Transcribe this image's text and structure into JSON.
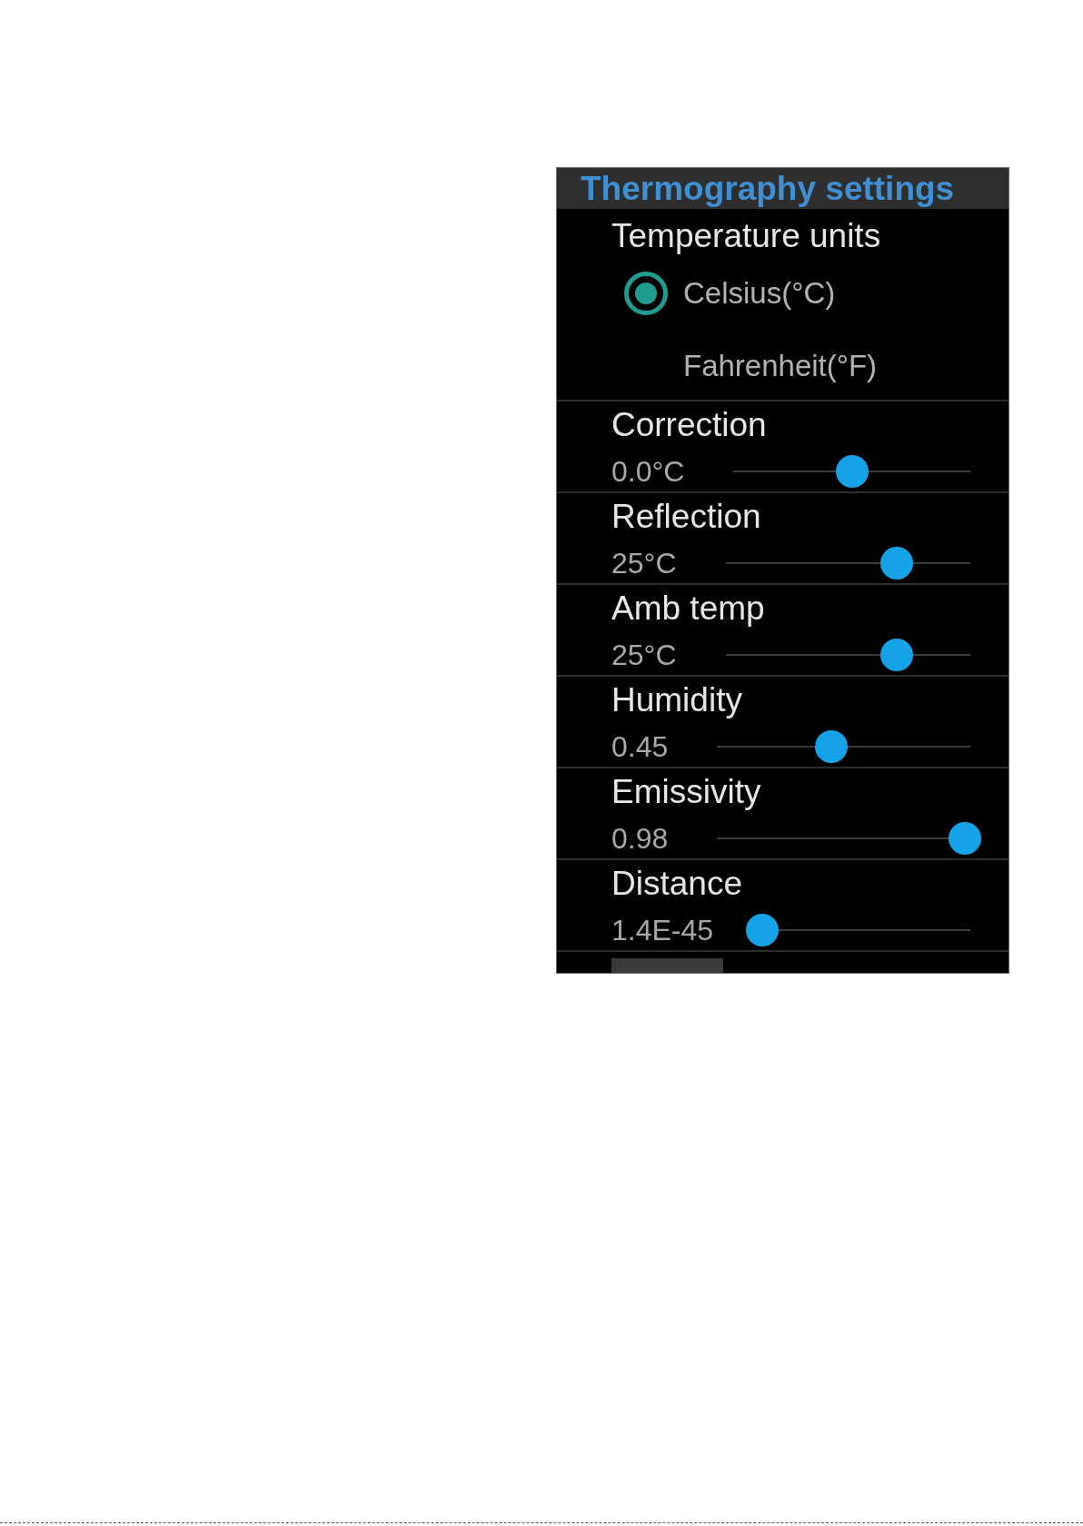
{
  "panel": {
    "title": "Thermography settings"
  },
  "temperature_units": {
    "label": "Temperature units",
    "options": [
      {
        "label": "Celsius(°C)",
        "selected": true
      },
      {
        "label": "Fahrenheit(°F)",
        "selected": false
      }
    ]
  },
  "sliders": [
    {
      "label": "Correction",
      "reading": "0.0°C",
      "level": 0.5
    },
    {
      "label": "Reflection",
      "reading": "25°C",
      "level": 0.7
    },
    {
      "label": "Amb temp",
      "reading": "25°C",
      "level": 0.7
    },
    {
      "label": "Humidity",
      "reading": "0.45",
      "level": 0.45
    },
    {
      "label": "Emissivity",
      "reading": "0.98",
      "level": 0.98
    },
    {
      "label": "Distance",
      "reading": "1.4E-45",
      "level": 0
    }
  ]
}
